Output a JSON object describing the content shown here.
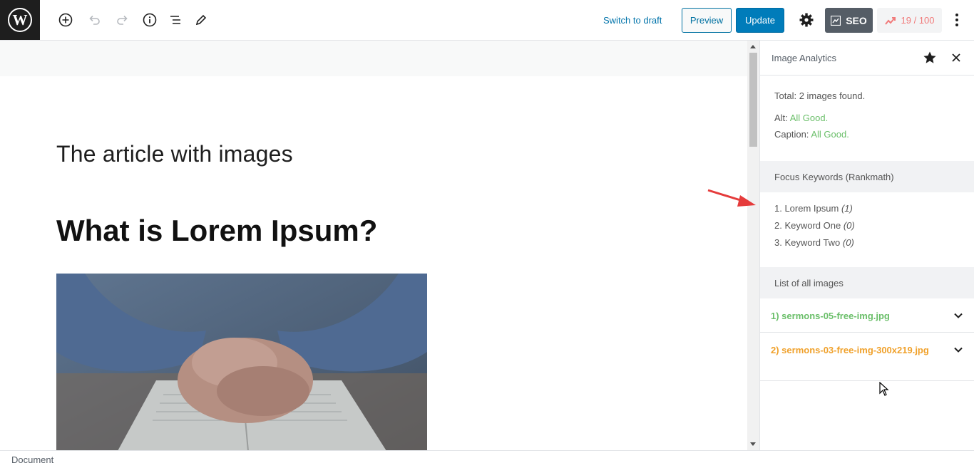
{
  "toolbar": {
    "switch_to_draft": "Switch to draft",
    "preview": "Preview",
    "update": "Update",
    "seo": "SEO",
    "score": "19 / 100",
    "accent": "#007cba"
  },
  "editor": {
    "title": "The article with images",
    "heading": "What is Lorem Ipsum?"
  },
  "sidebar": {
    "title": "Image Analytics",
    "summary": {
      "total_label": "Total:",
      "total_value": "2 images found.",
      "alt_label": "Alt:",
      "alt_value": "All Good.",
      "caption_label": "Caption:",
      "caption_value": "All Good."
    },
    "focus_keywords": {
      "heading": "Focus Keywords (Rankmath)",
      "items": [
        {
          "label": "1. Lorem Ipsum",
          "count": "(1)"
        },
        {
          "label": "2. Keyword One",
          "count": "(0)"
        },
        {
          "label": "3. Keyword Two",
          "count": "(0)"
        }
      ]
    },
    "images": {
      "heading": "List of all images",
      "items": [
        {
          "name": "1) sermons-05-free-img.jpg",
          "color": "#6bbf6a"
        },
        {
          "name": "2) sermons-03-free-img-300x219.jpg",
          "color": "#f0a12b"
        }
      ]
    }
  },
  "footer": {
    "breadcrumb": "Document"
  }
}
